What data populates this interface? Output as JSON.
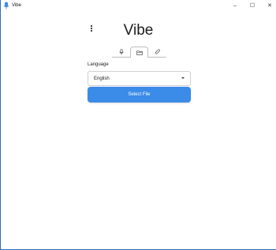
{
  "window": {
    "title": "Vibe",
    "controls": {
      "minimize": "–",
      "maximize": "☐",
      "close": "✕"
    }
  },
  "app": {
    "heading": "Vibe",
    "menu_icon": "kebab-menu-icon"
  },
  "tabs": [
    {
      "icon": "microphone-icon",
      "active": false
    },
    {
      "icon": "folder-icon",
      "active": true
    },
    {
      "icon": "link-icon",
      "active": false
    }
  ],
  "form": {
    "language_label": "Language",
    "language_value": "English",
    "submit_label": "Select File"
  },
  "colors": {
    "accent": "#3b8be8",
    "window_border": "#2b6fb6"
  }
}
